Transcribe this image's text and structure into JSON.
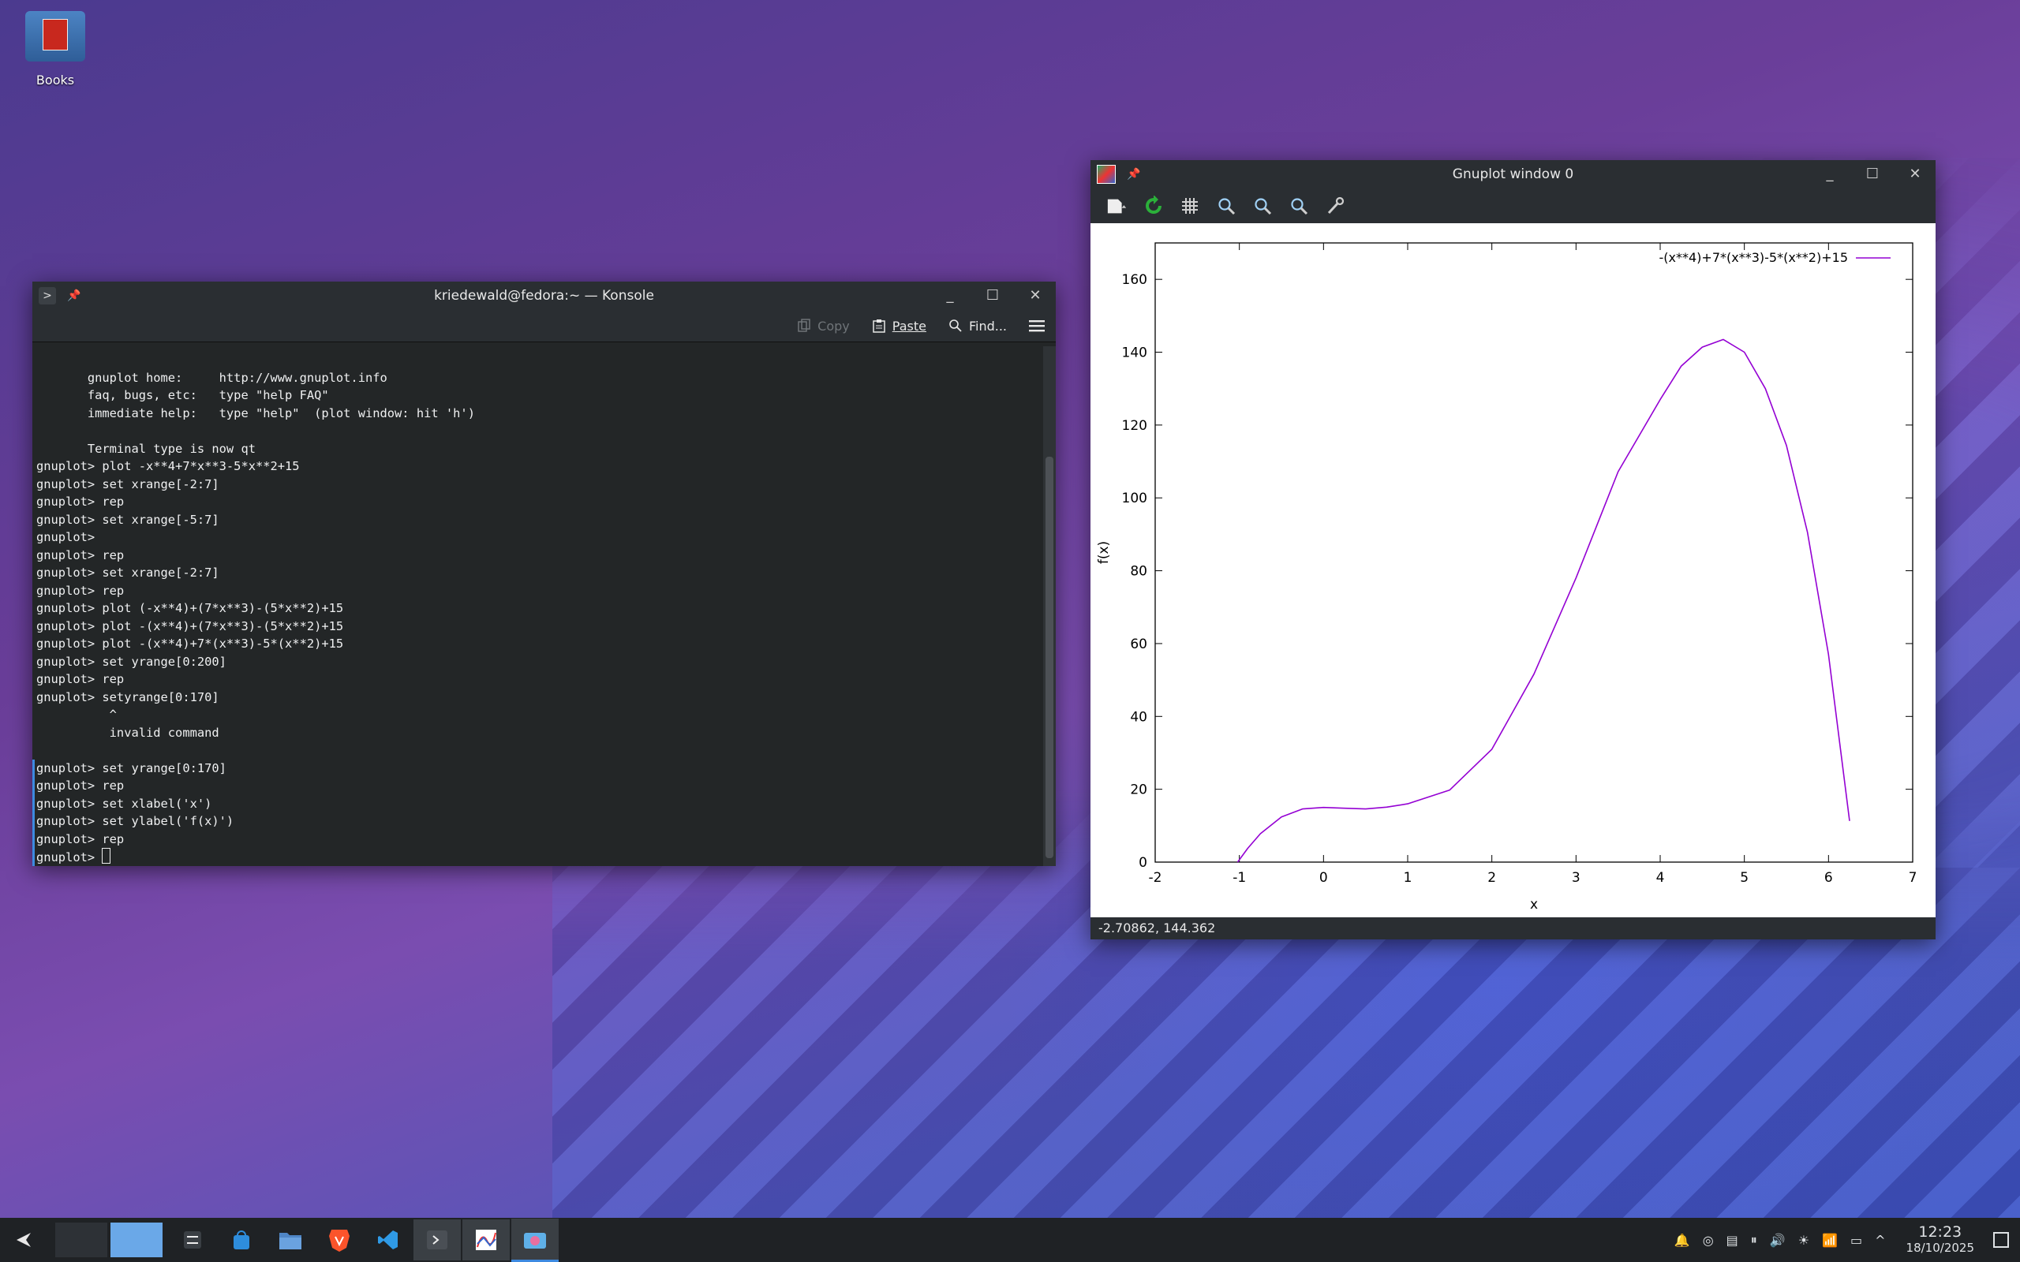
{
  "desktop": {
    "icon_label": "Books"
  },
  "konsole": {
    "title": "kriedewald@fedora:~ — Konsole",
    "toolbar": {
      "copy": "Copy",
      "paste": "Paste",
      "find": "Find..."
    },
    "lines": [
      "",
      "       gnuplot home:     http://www.gnuplot.info",
      "       faq, bugs, etc:   type \"help FAQ\"",
      "       immediate help:   type \"help\"  (plot window: hit 'h')",
      "",
      "       Terminal type is now qt",
      "gnuplot> plot -x**4+7*x**3-5*x**2+15",
      "gnuplot> set xrange[-2:7]",
      "gnuplot> rep",
      "gnuplot> set xrange[-5:7]",
      "gnuplot> ",
      "gnuplot> rep",
      "gnuplot> set xrange[-2:7]",
      "gnuplot> rep",
      "gnuplot> plot (-x**4)+(7*x**3)-(5*x**2)+15",
      "gnuplot> plot -(x**4)+(7*x**3)-(5*x**2)+15",
      "gnuplot> plot -(x**4)+7*(x**3)-5*(x**2)+15",
      "gnuplot> set yrange[0:200]",
      "gnuplot> rep",
      "gnuplot> setyrange[0:170]",
      "          ^",
      "          invalid command",
      "",
      "gnuplot> set yrange[0:170]",
      "gnuplot> rep",
      "gnuplot> set xlabel('x')",
      "gnuplot> set ylabel('f(x)')",
      "gnuplot> rep",
      "gnuplot> "
    ]
  },
  "gnuplot": {
    "title": "Gnuplot window 0",
    "status": "-2.70862,  144.362"
  },
  "chart_data": {
    "type": "line",
    "xlabel": "x",
    "ylabel": "f(x)",
    "xlim": [
      -2,
      7
    ],
    "ylim": [
      0,
      170
    ],
    "x_ticks": [
      "-2",
      "-1",
      "0",
      "1",
      "2",
      "3",
      "4",
      "5",
      "6",
      "7"
    ],
    "y_ticks": [
      "0",
      "20",
      "40",
      "60",
      "80",
      "100",
      "120",
      "140",
      "160"
    ],
    "legend_position": "top-right",
    "series": [
      {
        "name": "-(x**4)+7*(x**3)-5*(x**2)+15",
        "color": "#9400d3",
        "x": [
          -1.02,
          -0.9,
          -0.75,
          -0.5,
          -0.25,
          0,
          0.25,
          0.5,
          0.75,
          1,
          1.5,
          2,
          2.5,
          3,
          3.5,
          4,
          4.25,
          4.5,
          4.75,
          5,
          5.25,
          5.5,
          5.75,
          6,
          6.25
        ],
        "values": [
          0,
          3.8,
          7.8,
          12.4,
          14.6,
          15,
          14.8,
          14.6,
          15.1,
          16,
          19.8,
          31,
          51.6,
          78,
          107.2,
          127,
          136.2,
          141.4,
          143.5,
          140,
          130,
          114.4,
          90.5,
          57,
          11.3
        ]
      }
    ]
  },
  "taskbar": {
    "clock_time": "12:23",
    "clock_date": "18/10/2025"
  }
}
